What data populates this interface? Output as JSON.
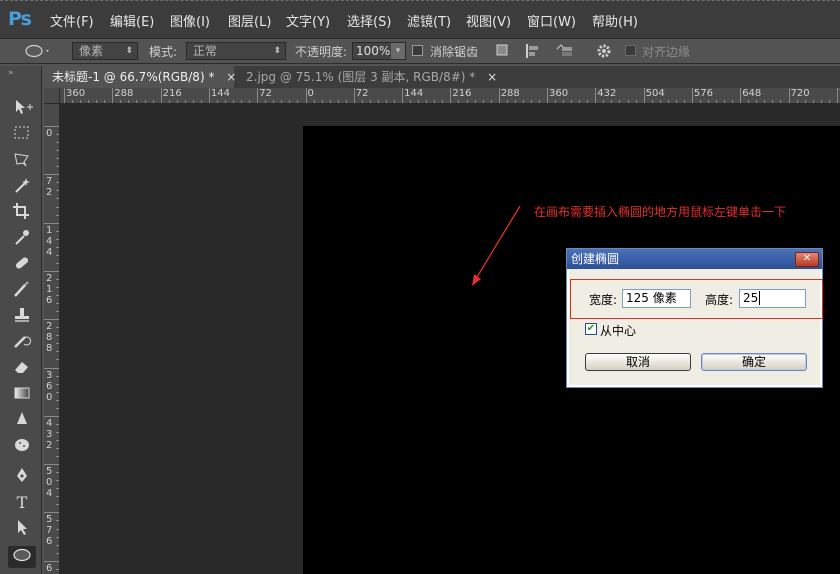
{
  "app": {
    "logo": "Ps"
  },
  "menu": [
    "文件(F)",
    "编辑(E)",
    "图像(I)",
    "图层(L)",
    "文字(Y)",
    "选择(S)",
    "滤镜(T)",
    "视图(V)",
    "窗口(W)",
    "帮助(H)"
  ],
  "options": {
    "shape_mode": "像素",
    "mode_label": "模式:",
    "mode_value": "正常",
    "opacity_label": "不透明度:",
    "opacity_value": "100%",
    "antialias_label": "消除锯齿",
    "align_edges_label": "对齐边缘"
  },
  "tabs": [
    {
      "label": "未标题-1 @ 66.7%(RGB/8) *",
      "close": "×",
      "active": true
    },
    {
      "label": "2.jpg @ 75.1% (图层 3 副本, RGB/8#) *",
      "close": "×",
      "active": false
    }
  ],
  "ruler_top": [
    "360",
    "288",
    "216",
    "144",
    "72",
    "0",
    "72",
    "144",
    "216",
    "288",
    "360",
    "432",
    "504",
    "576",
    "648",
    "720",
    "7"
  ],
  "ruler_left": [
    "0",
    "7\n2",
    "1\n4\n4",
    "2\n1\n6",
    "2\n8\n8",
    "3\n6\n0",
    "4\n3\n2",
    "5\n0\n4",
    "5\n7\n6",
    "6"
  ],
  "annotation": "在画布需要插入椭圆的地方用鼠标左键单击一下",
  "dialog": {
    "title": "创建椭圆",
    "close": "✕",
    "width_label": "宽度:",
    "width_value": "125 像素",
    "height_label": "高度:",
    "height_value": "25",
    "from_center_label": "从中心",
    "from_center_checked": true,
    "cancel_label": "取消",
    "ok_label": "确定"
  },
  "colors": {
    "accent_red": "#e0302c",
    "dialog_title": "#2b4f97",
    "workspace": "#292929",
    "canvas": "#000000"
  }
}
